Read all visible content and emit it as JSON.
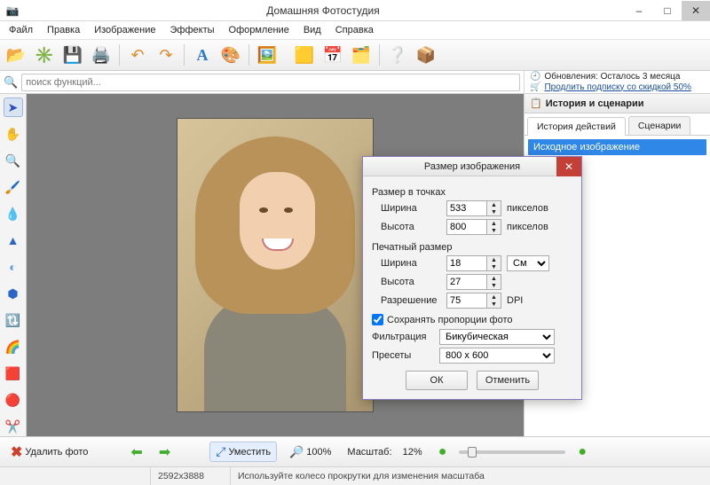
{
  "app": {
    "title": "Домашняя Фотостудия"
  },
  "winbuttons": {
    "min": "–",
    "max": "□",
    "close": "✕"
  },
  "menu": [
    "Файл",
    "Правка",
    "Изображение",
    "Эффекты",
    "Оформление",
    "Вид",
    "Справка"
  ],
  "search": {
    "placeholder": "поиск функций..."
  },
  "update": {
    "line1_prefix": "Обновления: ",
    "line1_value": "Осталось  3 месяца",
    "line2_link": "Продлить подписку со скидкой 50%"
  },
  "rightpanel": {
    "title": "История и сценарии",
    "tab1": "История действий",
    "tab2": "Сценарии",
    "item0": "Исходное изображение"
  },
  "bottom": {
    "delete": "Удалить фото",
    "fit": "Уместить",
    "zoom100": "100%",
    "scale_label": "Масштаб:",
    "scale_value": "12%"
  },
  "status": {
    "dims": "2592x3888",
    "hint": "Используйте колесо прокрутки для изменения масштаба"
  },
  "dialog": {
    "title": "Размер изображения",
    "section1": "Размер в точках",
    "width_lbl": "Ширина",
    "height_lbl": "Высота",
    "width_px": "533",
    "height_px": "800",
    "px_unit": "пикселов",
    "section2": "Печатный размер",
    "width_cm": "18",
    "height_cm": "27",
    "cm_unit": "См",
    "res_lbl": "Разрешение",
    "res_val": "75",
    "res_unit": "DPI",
    "keep_aspect": "Сохранять пропорции фото",
    "filter_lbl": "Фильтрация",
    "filter_val": "Бикубическая",
    "preset_lbl": "Пресеты",
    "preset_val": "800 x 600",
    "ok": "ОК",
    "cancel": "Отменить"
  }
}
